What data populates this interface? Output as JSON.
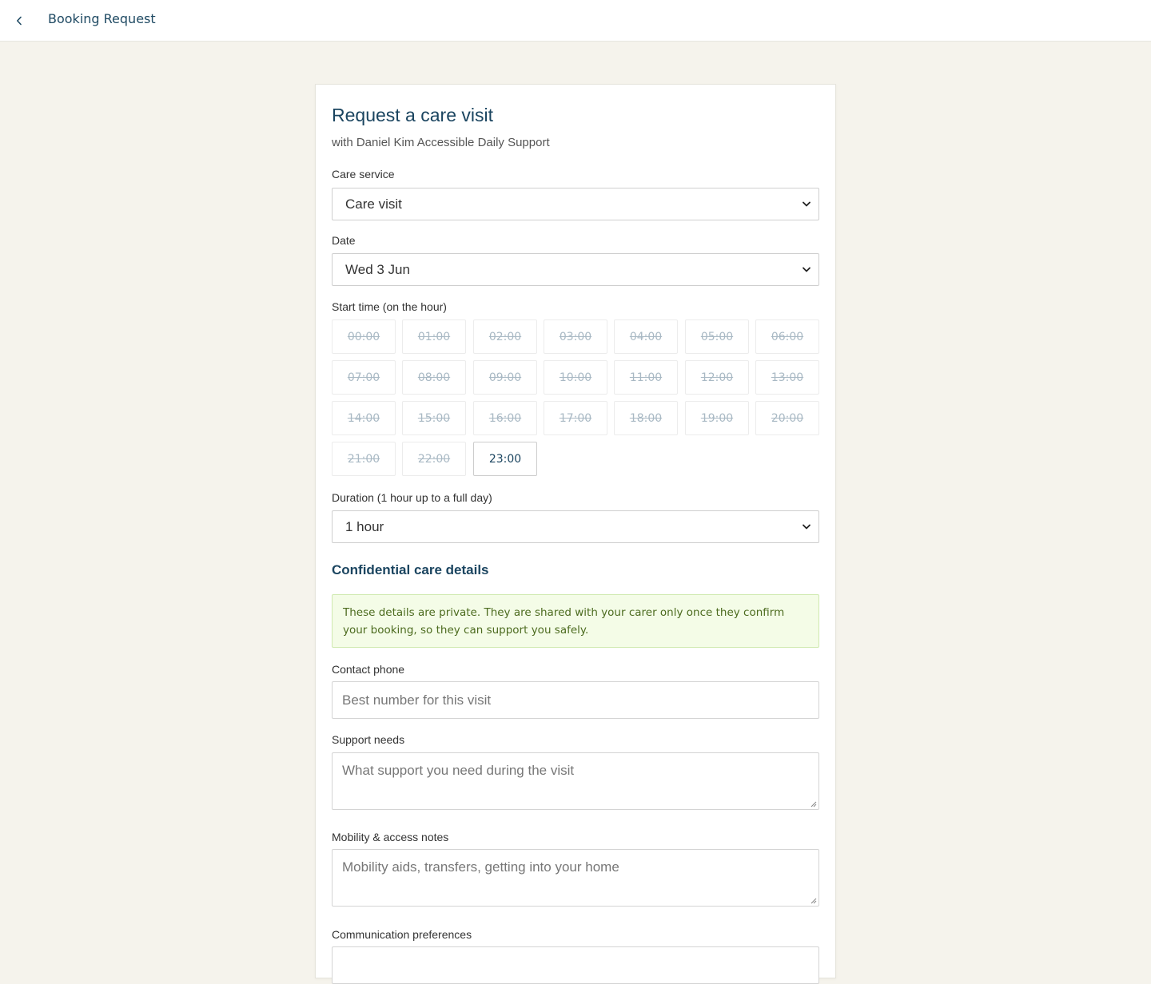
{
  "header": {
    "title": "Booking Request"
  },
  "form": {
    "title": "Request a care visit",
    "subtitle": "with Daniel Kim Accessible Daily Support",
    "care_service": {
      "label": "Care service",
      "value": "Care visit"
    },
    "date": {
      "label": "Date",
      "value": "Wed 3 Jun"
    },
    "start_time": {
      "label": "Start time (on the hour)",
      "slots": [
        {
          "time": "00:00",
          "available": false
        },
        {
          "time": "01:00",
          "available": false
        },
        {
          "time": "02:00",
          "available": false
        },
        {
          "time": "03:00",
          "available": false
        },
        {
          "time": "04:00",
          "available": false
        },
        {
          "time": "05:00",
          "available": false
        },
        {
          "time": "06:00",
          "available": false
        },
        {
          "time": "07:00",
          "available": false
        },
        {
          "time": "08:00",
          "available": false
        },
        {
          "time": "09:00",
          "available": false
        },
        {
          "time": "10:00",
          "available": false
        },
        {
          "time": "11:00",
          "available": false
        },
        {
          "time": "12:00",
          "available": false
        },
        {
          "time": "13:00",
          "available": false
        },
        {
          "time": "14:00",
          "available": false
        },
        {
          "time": "15:00",
          "available": false
        },
        {
          "time": "16:00",
          "available": false
        },
        {
          "time": "17:00",
          "available": false
        },
        {
          "time": "18:00",
          "available": false
        },
        {
          "time": "19:00",
          "available": false
        },
        {
          "time": "20:00",
          "available": false
        },
        {
          "time": "21:00",
          "available": false
        },
        {
          "time": "22:00",
          "available": false
        },
        {
          "time": "23:00",
          "available": true
        }
      ]
    },
    "duration": {
      "label": "Duration (1 hour up to a full day)",
      "value": "1 hour"
    },
    "confidential": {
      "heading": "Confidential care details",
      "notice": "These details are private. They are shared with your carer only once they confirm your booking, so they can support you safely."
    },
    "contact_phone": {
      "label": "Contact phone",
      "placeholder": "Best number for this visit"
    },
    "support_needs": {
      "label": "Support needs",
      "placeholder": "What support you need during the visit"
    },
    "mobility_notes": {
      "label": "Mobility & access notes",
      "placeholder": "Mobility aids, transfers, getting into your home"
    },
    "communication": {
      "label": "Communication preferences"
    }
  },
  "icons": {
    "back": "chevron-left-icon",
    "dropdown": "chevron-down-icon",
    "resize": "resize-grip-icon"
  },
  "colors": {
    "page_background": "#f5f3ec",
    "brand_text": "#1b4560",
    "notice_background": "#f4fce7",
    "notice_text": "#4c6b1f",
    "unavailable_slot": "#a9b9c4"
  }
}
